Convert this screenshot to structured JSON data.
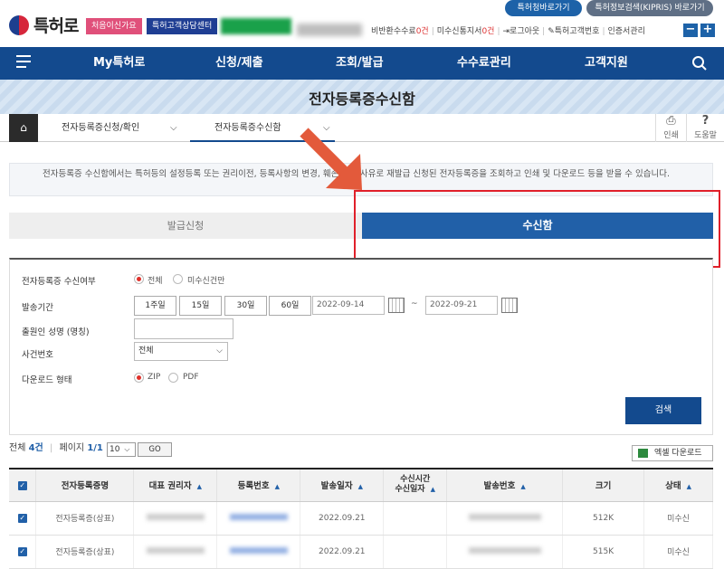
{
  "header": {
    "logo_text": "특허로",
    "btn_first": "처음이신가요",
    "btn_center": "특허고객상담센터",
    "btn_green": "",
    "util": {
      "refund_label": "비반환수수료",
      "refund_count": "0건",
      "unreceived_label": "미수신통지서",
      "unreceived_count": "0건",
      "logout": "로그아웃",
      "customer_no": "특허고객번호",
      "cert_manage": "인증서관리"
    },
    "top_link_1": "특허청바로가기",
    "top_link_2": "특허정보검색(KIPRIS) 바로가기",
    "zoom_out": "−",
    "zoom_in": "+"
  },
  "nav": {
    "items": [
      "My특허로",
      "신청/제출",
      "조회/발급",
      "수수료관리",
      "고객지원"
    ]
  },
  "page_title": "전자등록증수신함",
  "breadcrumb": {
    "level1": "전자등록증신청/확인",
    "level2": "전자등록증수신함",
    "print": "인쇄",
    "help": "도움말"
  },
  "info_text": "전자등록증 수신함에서는 특허등의 설정등록 또는 권리이전, 등록사항의 변경, 훼손 등의 사유로 재발급 신청된 전자등록증을 조회하고 인쇄 및 다운로드 등을 받을 수 있습니다.",
  "tabs": {
    "issue": "발급신청",
    "inbox": "수신함"
  },
  "form": {
    "receive_label": "전자등록증 수신여부",
    "opt_all": "전체",
    "opt_unreceived": "미수신건만",
    "period_label": "발송기간",
    "periods": [
      "1주일",
      "15일",
      "30일",
      "60일"
    ],
    "date_from": "2022-09-14",
    "date_sep": "~",
    "date_to": "2022-09-21",
    "applicant_label": "출원인 성명 (명칭)",
    "case_label": "사건번호",
    "case_value": "전체",
    "download_label": "다운로드 형태",
    "opt_zip": "ZIP",
    "opt_pdf": "PDF",
    "search": "검색"
  },
  "results": {
    "total_label": "전체",
    "total": "4건",
    "page_label": "페이지",
    "page": "1/1",
    "rows_per_page": "10",
    "go": "GO",
    "excel": "엑셀 다운로드"
  },
  "table": {
    "headers": [
      "전자등록증명",
      "대표 권리자",
      "등록번호",
      "발송일자",
      "수신시간\n수신일자",
      "발송번호",
      "크기",
      "상태"
    ],
    "rows": [
      {
        "name": "전자등록증(상표)",
        "date": "2022.09.21",
        "size": "512K",
        "status": "미수신"
      },
      {
        "name": "전자등록증(상표)",
        "date": "2022.09.21",
        "size": "515K",
        "status": "미수신"
      }
    ]
  }
}
